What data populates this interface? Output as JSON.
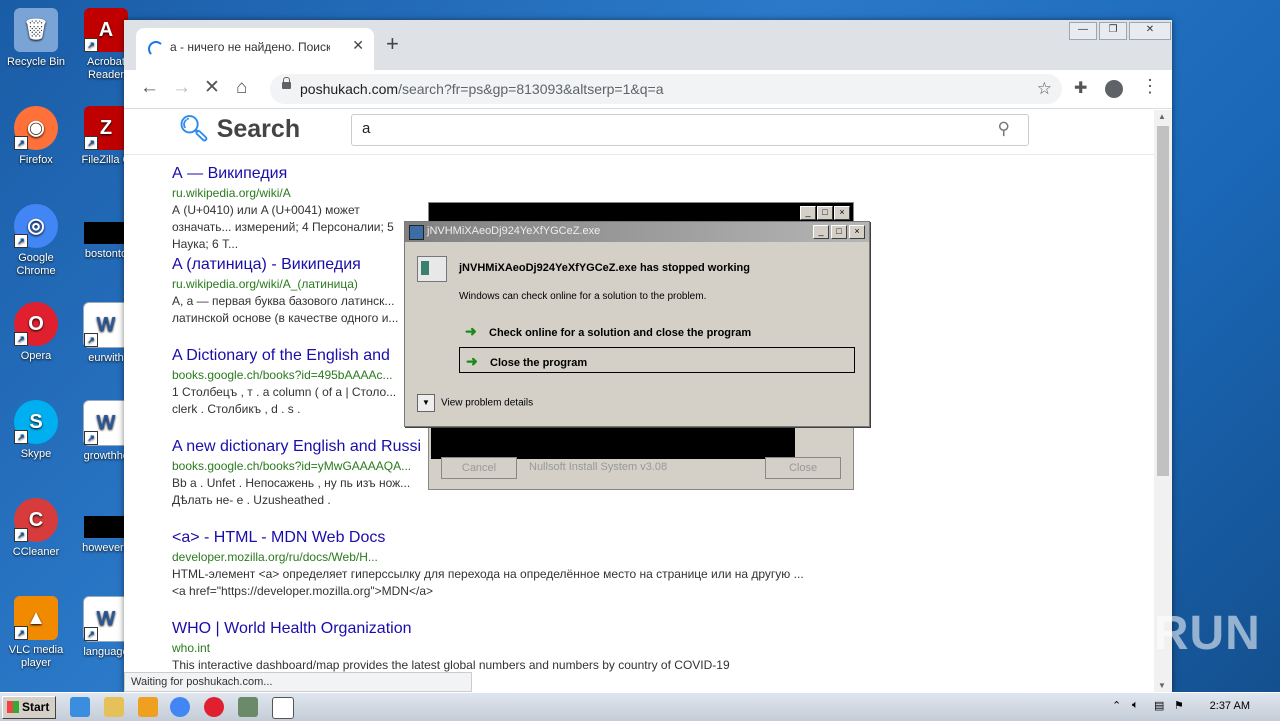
{
  "desktop": {
    "icons": [
      {
        "label": "Recycle Bin",
        "color": "#7aa4d6",
        "glyph": "🗑"
      },
      {
        "label": "Acrobat Reader",
        "color": "#c00000",
        "glyph": "A"
      },
      {
        "label": "Firefox",
        "color": "#ff7139",
        "glyph": "◉"
      },
      {
        "label": "FileZilla C",
        "color": "#bf0000",
        "glyph": "Z"
      },
      {
        "label": "Google Chrome",
        "color": "#4285f4",
        "glyph": "◎"
      },
      {
        "label": "bostonto",
        "color": "#000000",
        "glyph": ""
      },
      {
        "label": "Opera",
        "color": "#e0202f",
        "glyph": "O"
      },
      {
        "label": "eurwith",
        "color": "#2b5797",
        "glyph": "W"
      },
      {
        "label": "Skype",
        "color": "#00aff0",
        "glyph": "S"
      },
      {
        "label": "growthhc",
        "color": "#2b5797",
        "glyph": "W"
      },
      {
        "label": "CCleaner",
        "color": "#d83b3b",
        "glyph": "C"
      },
      {
        "label": "howevere",
        "color": "#000000",
        "glyph": ""
      },
      {
        "label": "VLC media player",
        "color": "#f28a00",
        "glyph": "▲"
      },
      {
        "label": "language",
        "color": "#2b5797",
        "glyph": "W"
      }
    ]
  },
  "browser": {
    "tab_title": "а - ничего не найдено. Поиск",
    "tab_close": "✕",
    "new_tab": "+",
    "url_host": "poshukach.com",
    "url_path": "/search?fr=ps&gp=813093&altserp=1&q=a",
    "status": "Waiting for poshukach.com...",
    "win_min": "—",
    "win_restore": "❐",
    "win_close": "✕"
  },
  "search": {
    "logo_text": "Search",
    "query": "a"
  },
  "results": [
    {
      "title": "А — Википедия",
      "url": "ru.wikipedia.org/wiki/А",
      "desc": "А (U+0410) или A (U+0041) может означать... измерений; 4 Персоналии; 5 Наука; 6 Т..."
    },
    {
      "title": "A (латиница) - Википедия",
      "url": "ru.wikipedia.org/wiki/A_(латиница)",
      "desc": "A, a — первая буква базового латинск... латинской основе (в качестве одного и..."
    },
    {
      "title": "A Dictionary of the English and",
      "url": "books.google.ch/books?id=495bAAAAc...",
      "desc": "1 Столбецъ , т . a column ( of a | Столо... clerk . Столбикъ , d . s ."
    },
    {
      "title": "A new dictionary English and Russi",
      "url": "books.google.ch/books?id=yMwGAAAAQA...",
      "desc": "Bb a . Unfet . Непосажень , ну пь изъ нож... Дѣлать не- е . Uzusheathed ."
    },
    {
      "title": "<a> - HTML - MDN Web Docs",
      "url": "developer.mozilla.org/ru/docs/Web/H...",
      "desc": "HTML-элемент <a> определяет гиперссылку для перехода на определённое место на странице или на другую ... <a href=\"https://developer.mozilla.org\">MDN</a>"
    },
    {
      "title": "WHO | World Health Organization",
      "url": "who.int",
      "desc": "This interactive dashboard/map provides the latest global numbers and numbers by country of COVID-19"
    }
  ],
  "nsis": {
    "cancel": "Cancel",
    "label": "Nullsoft Install System v3.08",
    "close": "Close"
  },
  "crash": {
    "title": "jNVHMiXAeoDj924YeXfYGCeZ.exe",
    "heading": "jNVHMiXAeoDj924YeXfYGCeZ.exe has stopped working",
    "sub": "Windows can check online for a solution to the problem.",
    "option1": "Check online for a solution and close the program",
    "option2": "Close the program",
    "details": "View problem details"
  },
  "watermark": "ANY RUN",
  "taskbar": {
    "start": "Start",
    "clock": "2:37 AM"
  }
}
